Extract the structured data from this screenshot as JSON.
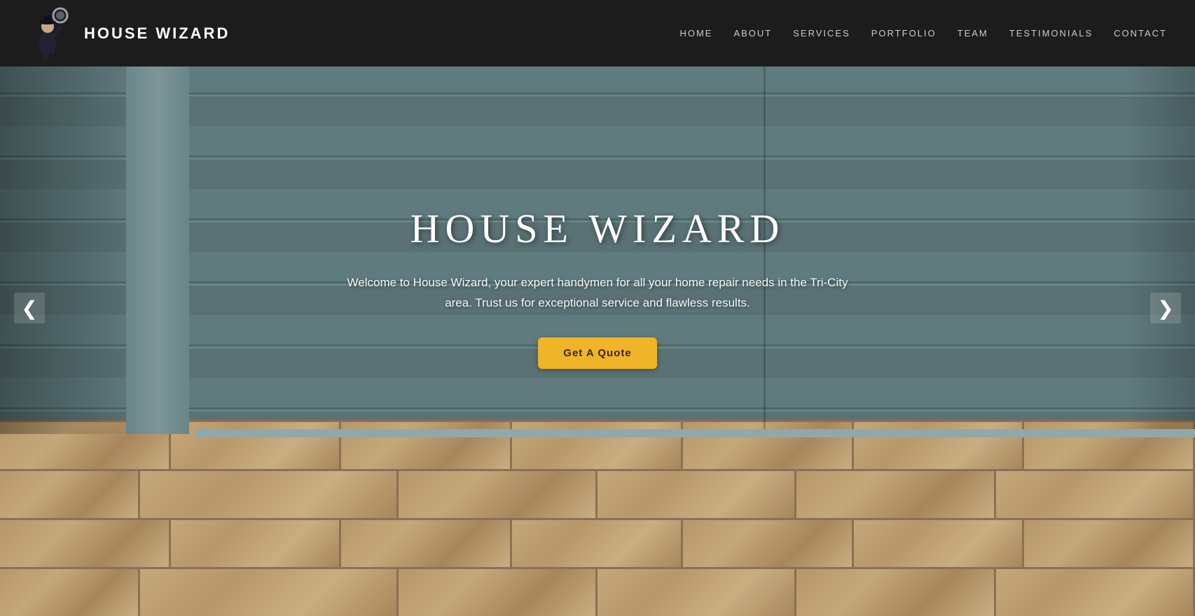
{
  "site": {
    "logo_text": "HOUSE WIZARD",
    "tagline": "HOUSE WIZARD"
  },
  "nav": {
    "items": [
      {
        "label": "HOME",
        "href": "#home"
      },
      {
        "label": "ABOUT",
        "href": "#about"
      },
      {
        "label": "SERVICES",
        "href": "#services"
      },
      {
        "label": "PORTFOLIO",
        "href": "#portfolio"
      },
      {
        "label": "TEAM",
        "href": "#team"
      },
      {
        "label": "TESTIMONIALS",
        "href": "#testimonials"
      },
      {
        "label": "CONTACT",
        "href": "#contact"
      }
    ]
  },
  "hero": {
    "title": "HOUSE WIZARD",
    "subtitle": "Welcome to House Wizard, your expert handymen for all your home repair needs in the Tri-City\narea. Trust us for exceptional service and flawless results.",
    "cta_label": "Get A Quote",
    "arrow_left": "❮",
    "arrow_right": "❯"
  }
}
